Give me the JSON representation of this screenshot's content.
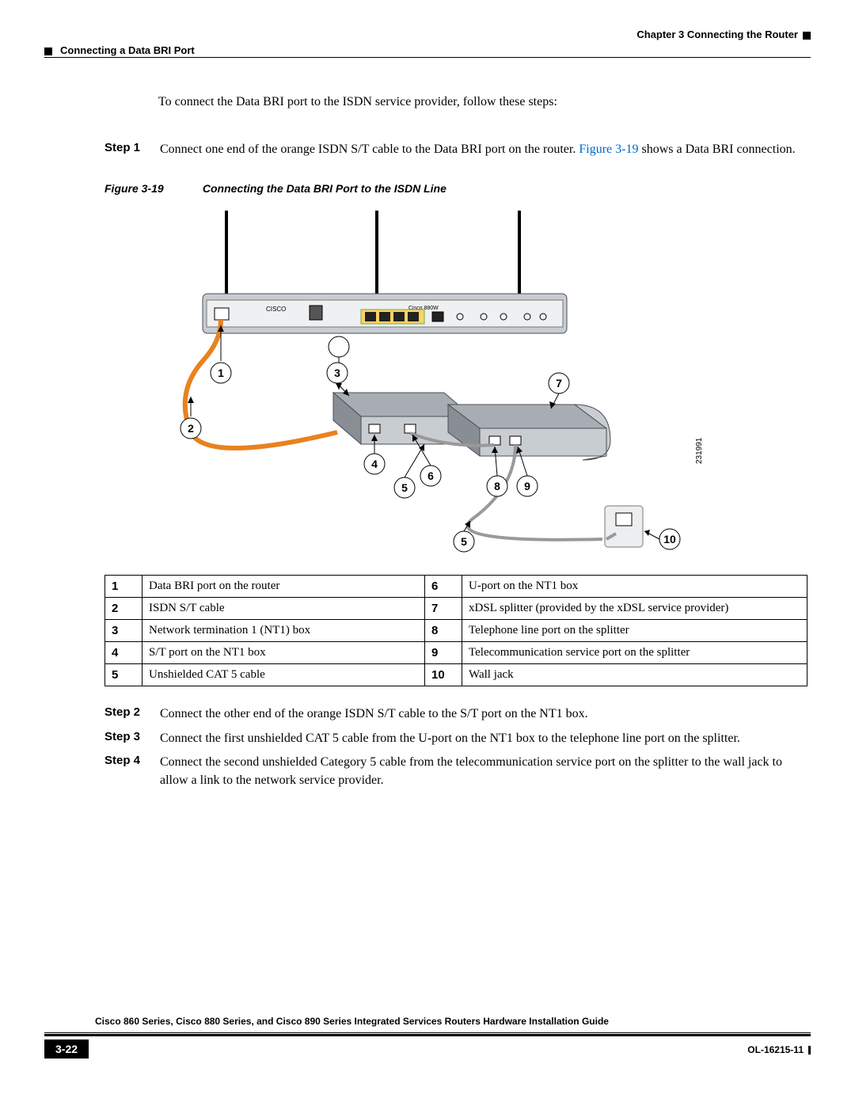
{
  "header": {
    "chapter": "Chapter 3      Connecting the Router",
    "section": "Connecting a Data BRI Port"
  },
  "intro": "To connect the Data BRI port to the ISDN service provider, follow these steps:",
  "steps": [
    {
      "label": "Step 1",
      "text_a": "Connect one end of the orange ISDN S/T cable to the Data BRI port on the router. ",
      "link": "Figure 3-19",
      "text_b": " shows a Data BRI connection."
    },
    {
      "label": "Step 2",
      "text_a": "Connect the other end of the orange ISDN S/T cable to the S/T port on the NT1 box.",
      "link": "",
      "text_b": ""
    },
    {
      "label": "Step 3",
      "text_a": "Connect the first unshielded CAT 5 cable from the U-port on the NT1 box to the telephone line port on the splitter.",
      "link": "",
      "text_b": ""
    },
    {
      "label": "Step 4",
      "text_a": "Connect the second unshielded Category 5 cable from the telecommunication service port on the splitter to the wall jack to allow a link to the network service provider.",
      "link": "",
      "text_b": ""
    }
  ],
  "figure": {
    "num": "Figure 3-19",
    "title": "Connecting the Data BRI Port to the ISDN Line",
    "id_side": "231991",
    "router_label": "Cisco 880W"
  },
  "legend": [
    {
      "n1": "1",
      "d1": "Data BRI port on the router",
      "n2": "6",
      "d2": "U-port on the NT1 box"
    },
    {
      "n1": "2",
      "d1": "ISDN S/T cable",
      "n2": "7",
      "d2": "xDSL splitter (provided by the xDSL service provider)"
    },
    {
      "n1": "3",
      "d1": "Network termination 1 (NT1) box",
      "n2": "8",
      "d2": "Telephone line port on the splitter"
    },
    {
      "n1": "4",
      "d1": "S/T port on the NT1 box",
      "n2": "9",
      "d2": "Telecommunication service port on the splitter"
    },
    {
      "n1": "5",
      "d1": "Unshielded CAT 5 cable",
      "n2": "10",
      "d2": "Wall jack"
    }
  ],
  "footer": {
    "title": "Cisco 860 Series, Cisco 880 Series, and Cisco 890 Series Integrated Services Routers Hardware Installation Guide",
    "page": "3-22",
    "doc_id": "OL-16215-11"
  }
}
